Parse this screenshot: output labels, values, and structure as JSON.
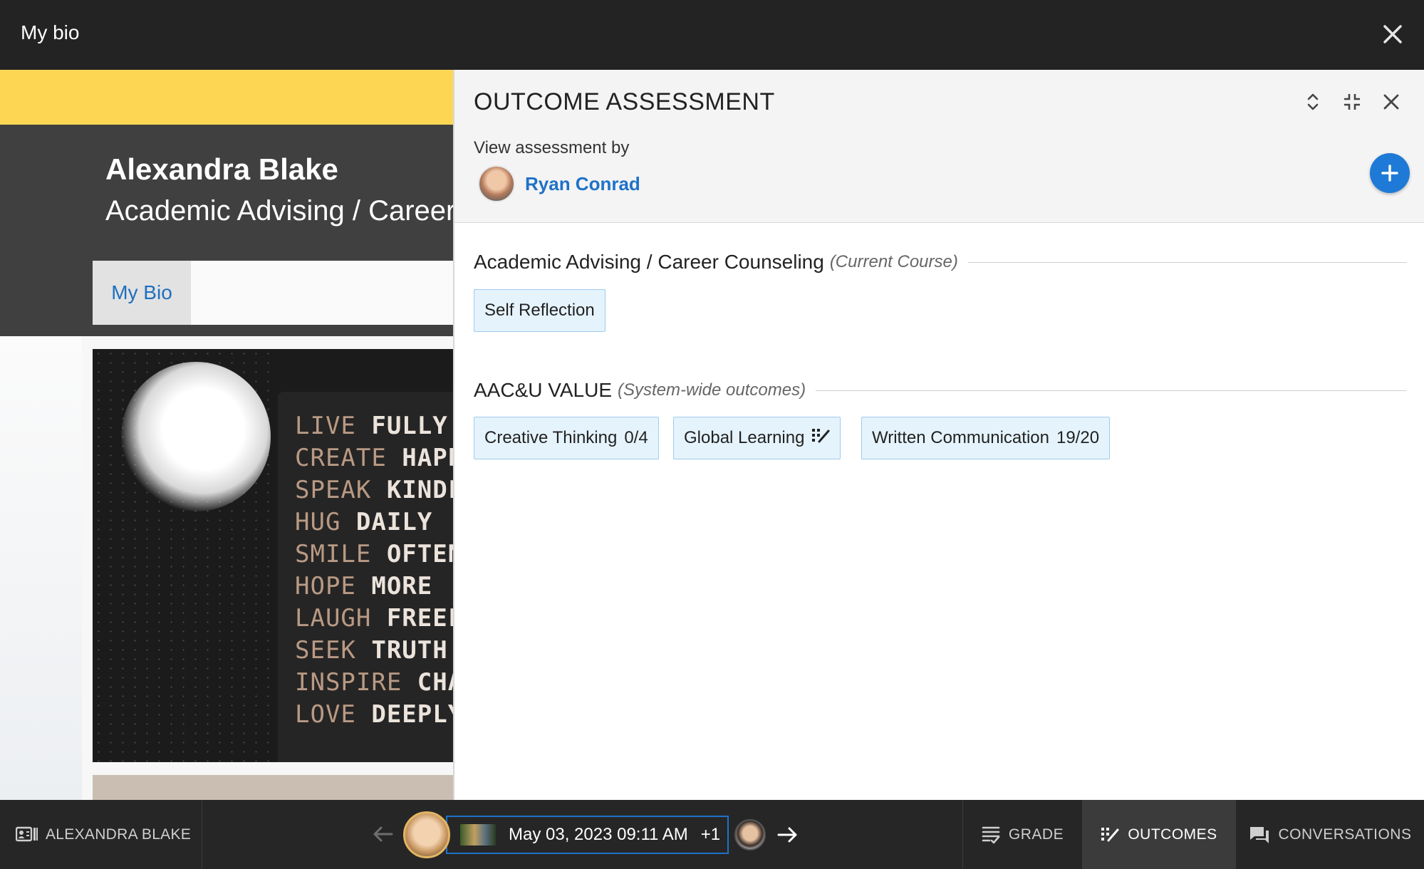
{
  "window": {
    "title": "My bio"
  },
  "bio": {
    "name": "Alexandra Blake",
    "course": "Academic Advising / Career Counseling",
    "tab_label": "My Bio"
  },
  "panel": {
    "title": "OUTCOME ASSESSMENT",
    "view_by_label": "View assessment by",
    "assessor": "Ryan Conrad",
    "groups": [
      {
        "name": "Academic Advising / Career Counseling",
        "subtitle": "(Current Course)",
        "chips": [
          {
            "label": "Self Reflection"
          }
        ]
      },
      {
        "name": "AAC&U VALUE",
        "subtitle": "(System-wide outcomes)",
        "chips": [
          {
            "label": "Creative Thinking",
            "score": "0/4"
          },
          {
            "label": "Global Learning",
            "icon": "outcomes-icon"
          },
          {
            "label": "Written Communication",
            "score": "19/20"
          }
        ]
      }
    ]
  },
  "bottom_bar": {
    "student_name": "ALEXANDRA BLAKE",
    "submission_date": "May 03, 2023 09:11 AM",
    "extra_count": "+1",
    "tabs": {
      "grade": "GRADE",
      "outcomes": "OUTCOMES",
      "conversations": "CONVERSATIONS"
    },
    "active_tab": "outcomes"
  },
  "colors": {
    "topbar": "#232323",
    "accent_blue": "#1e72c8",
    "banner_yellow": "#fdd754",
    "chip_bg": "#e5f3fd",
    "chip_border": "#9fcbec"
  }
}
